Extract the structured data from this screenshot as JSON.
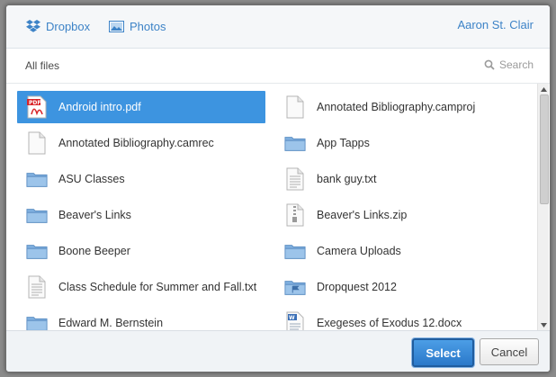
{
  "header": {
    "tabs": [
      {
        "label": "Dropbox",
        "icon": "dropbox-icon"
      },
      {
        "label": "Photos",
        "icon": "photos-icon"
      }
    ],
    "user_name": "Aaron St. Clair"
  },
  "breadcrumb": "All files",
  "search": {
    "placeholder": "Search"
  },
  "files": [
    {
      "name": "Android intro.pdf",
      "type": "pdf",
      "selected": true
    },
    {
      "name": "Annotated Bibliography.camproj",
      "type": "doc"
    },
    {
      "name": "Annotated Bibliography.camrec",
      "type": "doc"
    },
    {
      "name": "App Tapps",
      "type": "folder"
    },
    {
      "name": "ASU Classes",
      "type": "folder"
    },
    {
      "name": "bank guy.txt",
      "type": "text"
    },
    {
      "name": "Beaver's Links",
      "type": "folder"
    },
    {
      "name": "Beaver's Links.zip",
      "type": "zip"
    },
    {
      "name": "Boone Beeper",
      "type": "folder"
    },
    {
      "name": "Camera Uploads",
      "type": "folder"
    },
    {
      "name": "Class Schedule for Summer and Fall.txt",
      "type": "text"
    },
    {
      "name": "Dropquest 2012",
      "type": "folder-special"
    },
    {
      "name": "Edward M. Bernstein",
      "type": "folder"
    },
    {
      "name": "Exegeses of Exodus 12.docx",
      "type": "word"
    }
  ],
  "footer": {
    "select_label": "Select",
    "cancel_label": "Cancel"
  },
  "colors": {
    "accent": "#3d83c7",
    "selection": "#3d94e0",
    "folder": "#8ab6e0"
  }
}
